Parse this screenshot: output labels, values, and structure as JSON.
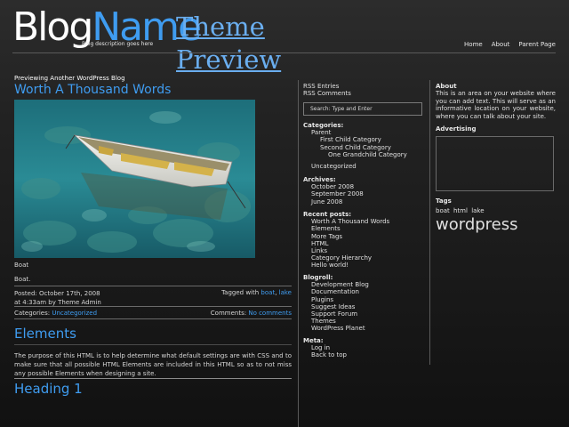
{
  "header": {
    "logo_part1": "Blog",
    "logo_part2": "Name",
    "tagline": "Blog description goes here",
    "theme_preview": "Theme Preview",
    "nav": [
      "Home",
      "About",
      "Parent Page"
    ]
  },
  "main": {
    "previewing": "Previewing Another WordPress Blog",
    "post_title": "Worth A Thousand Words",
    "caption": "Boat",
    "body": "Boat.",
    "posted": "Posted: October 17th, 2008",
    "posted_by": "at 4:33am by Theme Admin",
    "tagged_label": "Tagged with",
    "tags": [
      "boat",
      "lake"
    ],
    "categories_label": "Categories:",
    "category": "Uncategorized",
    "comments_label": "Comments:",
    "comments_value": "No comments",
    "section_title": "Elements",
    "paragraph": "The purpose of this HTML is to help determine what default settings are with CSS and to make sure that all possible HTML Elements are included in this HTML so as to not miss any possible Elements when designing a site.",
    "heading1": "Heading 1"
  },
  "sidebar": {
    "rss_entries": "RSS Entries",
    "rss_comments": "RSS Comments",
    "search_placeholder": "Search: Type and Enter",
    "categories_title": "Categories:",
    "categories": {
      "parent": "Parent",
      "first_child": "First Child Category",
      "second_child": "Second Child Category",
      "grandchild": "One Grandchild Category",
      "uncategorized": "Uncategorized"
    },
    "archives_title": "Archives:",
    "archives": [
      "October 2008",
      "September 2008",
      "June 2008"
    ],
    "recent_title": "Recent posts:",
    "recent": [
      "Worth A Thousand Words",
      "Elements",
      "More Tags",
      "HTML",
      "Links",
      "Category Hierarchy",
      "Hello world!"
    ],
    "blogroll_title": "Blogroll:",
    "blogroll": [
      "Development Blog",
      "Documentation",
      "Plugins",
      "Suggest Ideas",
      "Support Forum",
      "Themes",
      "WordPress Planet"
    ],
    "meta_title": "Meta:",
    "meta": [
      "Log in",
      "Back to top"
    ]
  },
  "right": {
    "about_title": "About",
    "about_text": "This is an area on your website where you can add text. This will serve as an informative location on your website, where you can talk about your site.",
    "advertising_title": "Advertising",
    "tags_title": "Tags",
    "tags_small": [
      "boat",
      "html",
      "lake"
    ],
    "tag_big": "wordpress"
  },
  "colors": {
    "accent": "#3f9cf0",
    "background": "#1e1e1e",
    "text": "#d6d6d6"
  }
}
